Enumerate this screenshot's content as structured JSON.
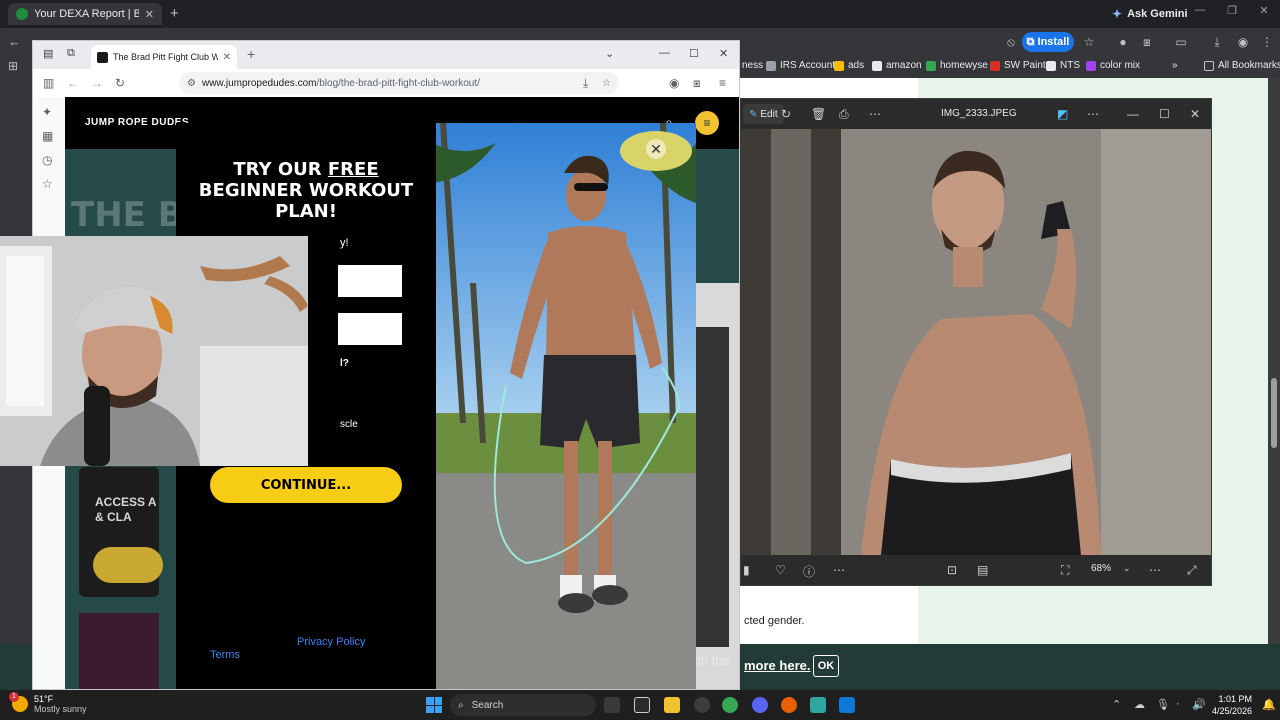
{
  "back_browser": {
    "tab_title": "Your DEXA Report | BodySpec",
    "ask_gemini": "Ask Gemini",
    "install_label": "Install",
    "bookmarks": [
      "ness",
      "IRS Account",
      "ads",
      "amazon",
      "homewyse",
      "SW Paint",
      "NTS",
      "color mix"
    ],
    "all_bookmarks": "All Bookmarks",
    "page_text": "cted gender.",
    "cookie_link": "more here.",
    "cookie_ok": "OK"
  },
  "photos": {
    "edit_label": "Edit",
    "title": "IMG_2333.JPEG",
    "zoom": "68%"
  },
  "front_browser": {
    "tab_title": "The Brad Pitt Fight Club Worko",
    "url_host": "www.jumpropedudes.com",
    "url_path": "/blog/the-brad-pitt-fight-club-workout/",
    "site": {
      "logo": "JUMP ROPE DUDES",
      "hero_title": "THE B",
      "card_text": "ACCESS A & CLA",
      "with_the": "with the"
    },
    "modal": {
      "title_1": "TRY OUR ",
      "title_free": "FREE",
      "title_2": "BEGINNER WORKOUT",
      "title_3": "PLAN!",
      "subtext": "y!",
      "question": "l?",
      "option": "scle",
      "continue": "CONTINUE...",
      "terms": "Terms",
      "privacy": "Privacy Policy"
    }
  },
  "taskbar": {
    "temp": "51°F",
    "weather": "Mostly sunny",
    "weather_badge": "1",
    "search": "Search",
    "time": "1:01 PM",
    "date": "4/25/2026"
  }
}
